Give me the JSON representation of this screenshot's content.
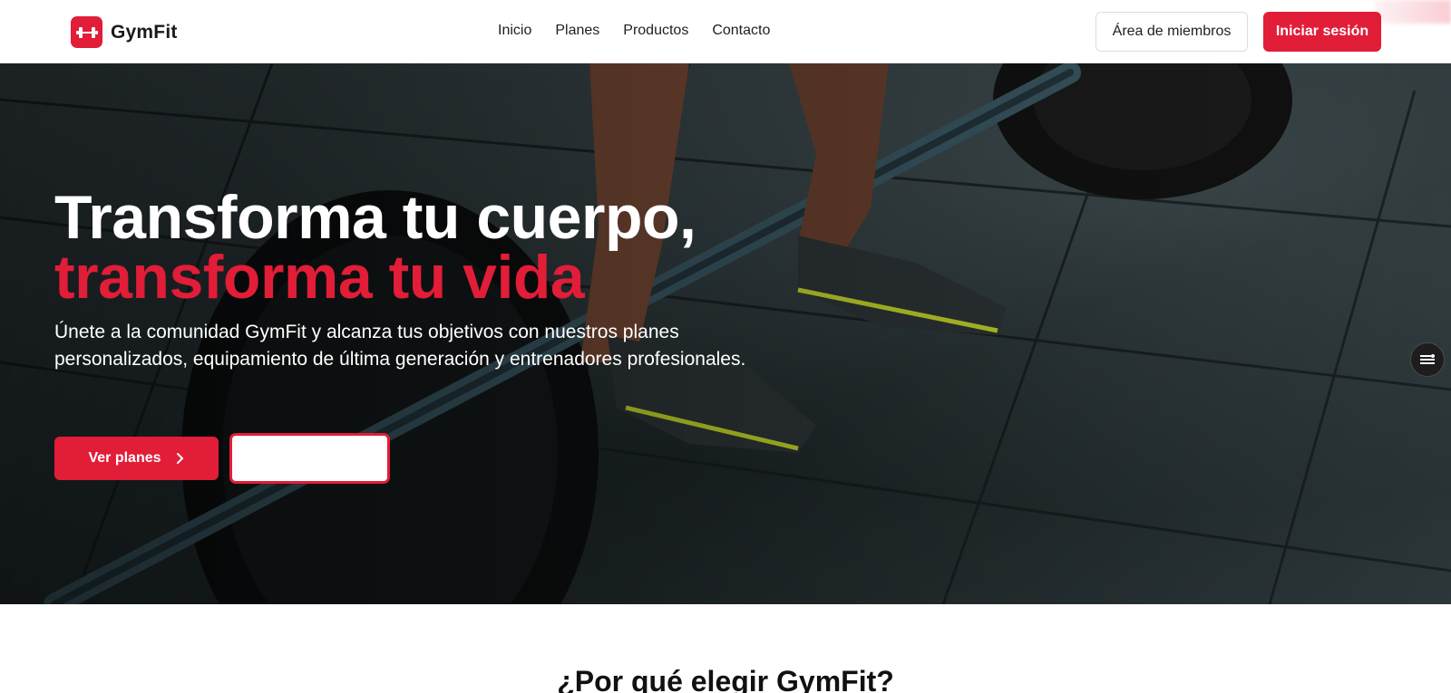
{
  "brand": {
    "name": "GymFit",
    "accent_color": "#e11d38",
    "icon": "dumbbell-icon"
  },
  "nav": {
    "items": [
      {
        "label": "Inicio"
      },
      {
        "label": "Planes"
      },
      {
        "label": "Productos"
      },
      {
        "label": "Contacto"
      }
    ]
  },
  "header_actions": {
    "members_label": "Área de miembros",
    "login_label": "Iniciar sesión"
  },
  "hero": {
    "title_line1": "Transforma tu cuerpo,",
    "title_line2": "transforma tu vida",
    "subtitle": "Únete a la comunidad GymFit y alcanza tus objetivos con nuestros planes personalizados, equipamiento de última generación y entrenadores profesionales.",
    "primary_cta": "Ver planes",
    "primary_cta_icon": "chevron-right-icon",
    "secondary_cta": "",
    "float_icon": "menu-list-icon"
  },
  "features": {
    "title": "¿Por qué elegir GymFit?"
  }
}
